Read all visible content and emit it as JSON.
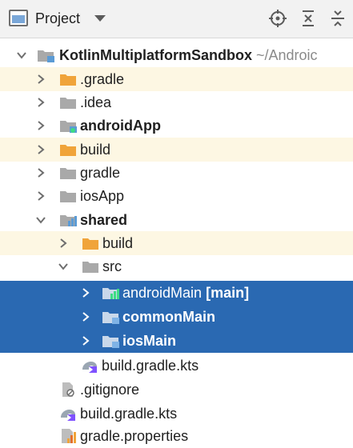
{
  "toolbar": {
    "title": "Project",
    "icons": [
      "project-view-icon",
      "chevron-down-icon",
      "locate-target-icon",
      "expand-all-icon",
      "collapse-all-icon"
    ]
  },
  "tree": {
    "root_label": "KotlinMultiplatformSandbox",
    "root_path": "~/Androic",
    "gradle_dir": ".gradle",
    "idea_dir": ".idea",
    "android_app": "androidApp",
    "build_dir": "build",
    "gradle": "gradle",
    "ios_app": "iosApp",
    "shared": "shared",
    "shared_build": "build",
    "src": "src",
    "android_main": "androidMain",
    "android_main_tag": "[main]",
    "common_main": "commonMain",
    "ios_main": "iosMain",
    "shared_build_gradle": "build.gradle.kts",
    "gitignore": ".gitignore",
    "root_build_gradle": "build.gradle.kts",
    "gradle_properties": "gradle.properties"
  },
  "colors": {
    "selection": "#2a69b2",
    "excluded_highlight": "#fdf7e3",
    "folder_gray": "#a9a9a9",
    "folder_orange": "#f0a43a",
    "module_blue": "#5b9bd5"
  }
}
